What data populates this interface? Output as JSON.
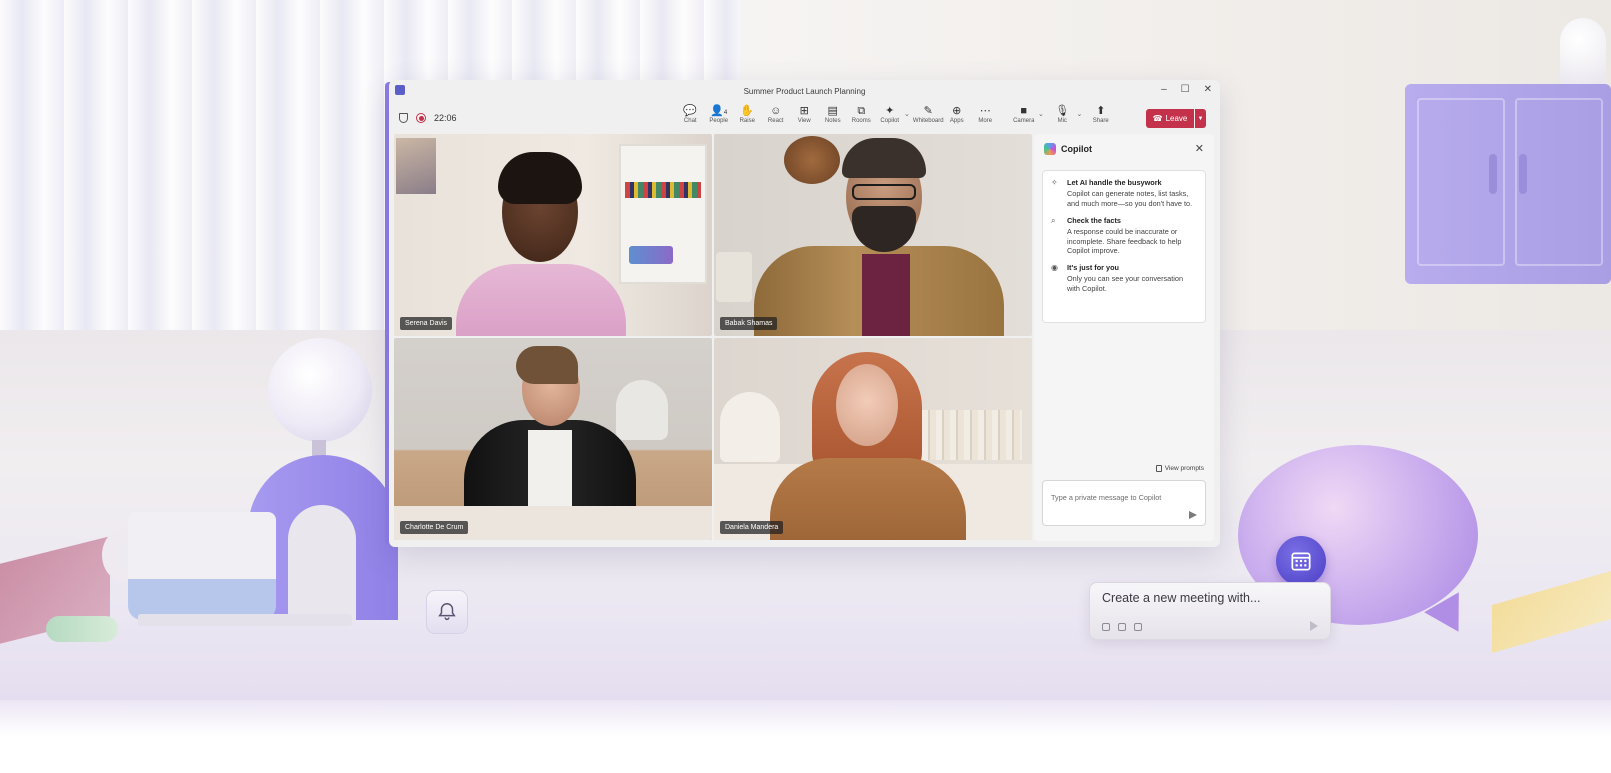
{
  "window": {
    "title": "Summer Product Launch Planning",
    "timer": "22:06",
    "controls": {
      "minimize": "–",
      "maximize": "☐",
      "close": "✕"
    }
  },
  "toolbar": {
    "buttons": [
      {
        "label": "Chat",
        "glyph": "💬"
      },
      {
        "label": "People",
        "glyph": "👤",
        "count": "4"
      },
      {
        "label": "Raise",
        "glyph": "✋"
      },
      {
        "label": "React",
        "glyph": "☺"
      },
      {
        "label": "View",
        "glyph": "⊞"
      },
      {
        "label": "Notes",
        "glyph": "▤"
      },
      {
        "label": "Rooms",
        "glyph": "⧉"
      },
      {
        "label": "Copilot",
        "glyph": "✦"
      },
      {
        "label": "Whiteboard",
        "glyph": "✎"
      },
      {
        "label": "Apps",
        "glyph": "⊕"
      },
      {
        "label": "More",
        "glyph": "⋯"
      },
      {
        "label": "Camera",
        "glyph": "■"
      },
      {
        "label": "Mic",
        "glyph": "🎙"
      },
      {
        "label": "Share",
        "glyph": "⬆"
      }
    ],
    "leave_label": "Leave"
  },
  "participants": [
    {
      "name": "Serena Davis"
    },
    {
      "name": "Babak Shamas"
    },
    {
      "name": "Charlotte De Crum"
    },
    {
      "name": "Daniela Mandera"
    }
  ],
  "copilot": {
    "title": "Copilot",
    "items": [
      {
        "icon": "sparkle-pen-icon",
        "title": "Let AI handle the busywork",
        "desc": "Copilot can generate notes, list tasks, and much more—so you don't have to."
      },
      {
        "icon": "magnifier-check-icon",
        "title": "Check the facts",
        "desc": "A response could be inaccurate or incomplete. Share feedback to help Copilot improve."
      },
      {
        "icon": "eye-icon",
        "title": "It's just for you",
        "desc": "Only you can see your conversation with Copilot."
      }
    ],
    "view_prompts": "View prompts",
    "input_placeholder": "Type a private message to Copilot"
  },
  "scene": {
    "meeting_prompt": "Create a new meeting with..."
  },
  "colors": {
    "leave": "#c4314b",
    "accent": "#8c7de8",
    "calendar_badge": "#4a3fc6"
  }
}
